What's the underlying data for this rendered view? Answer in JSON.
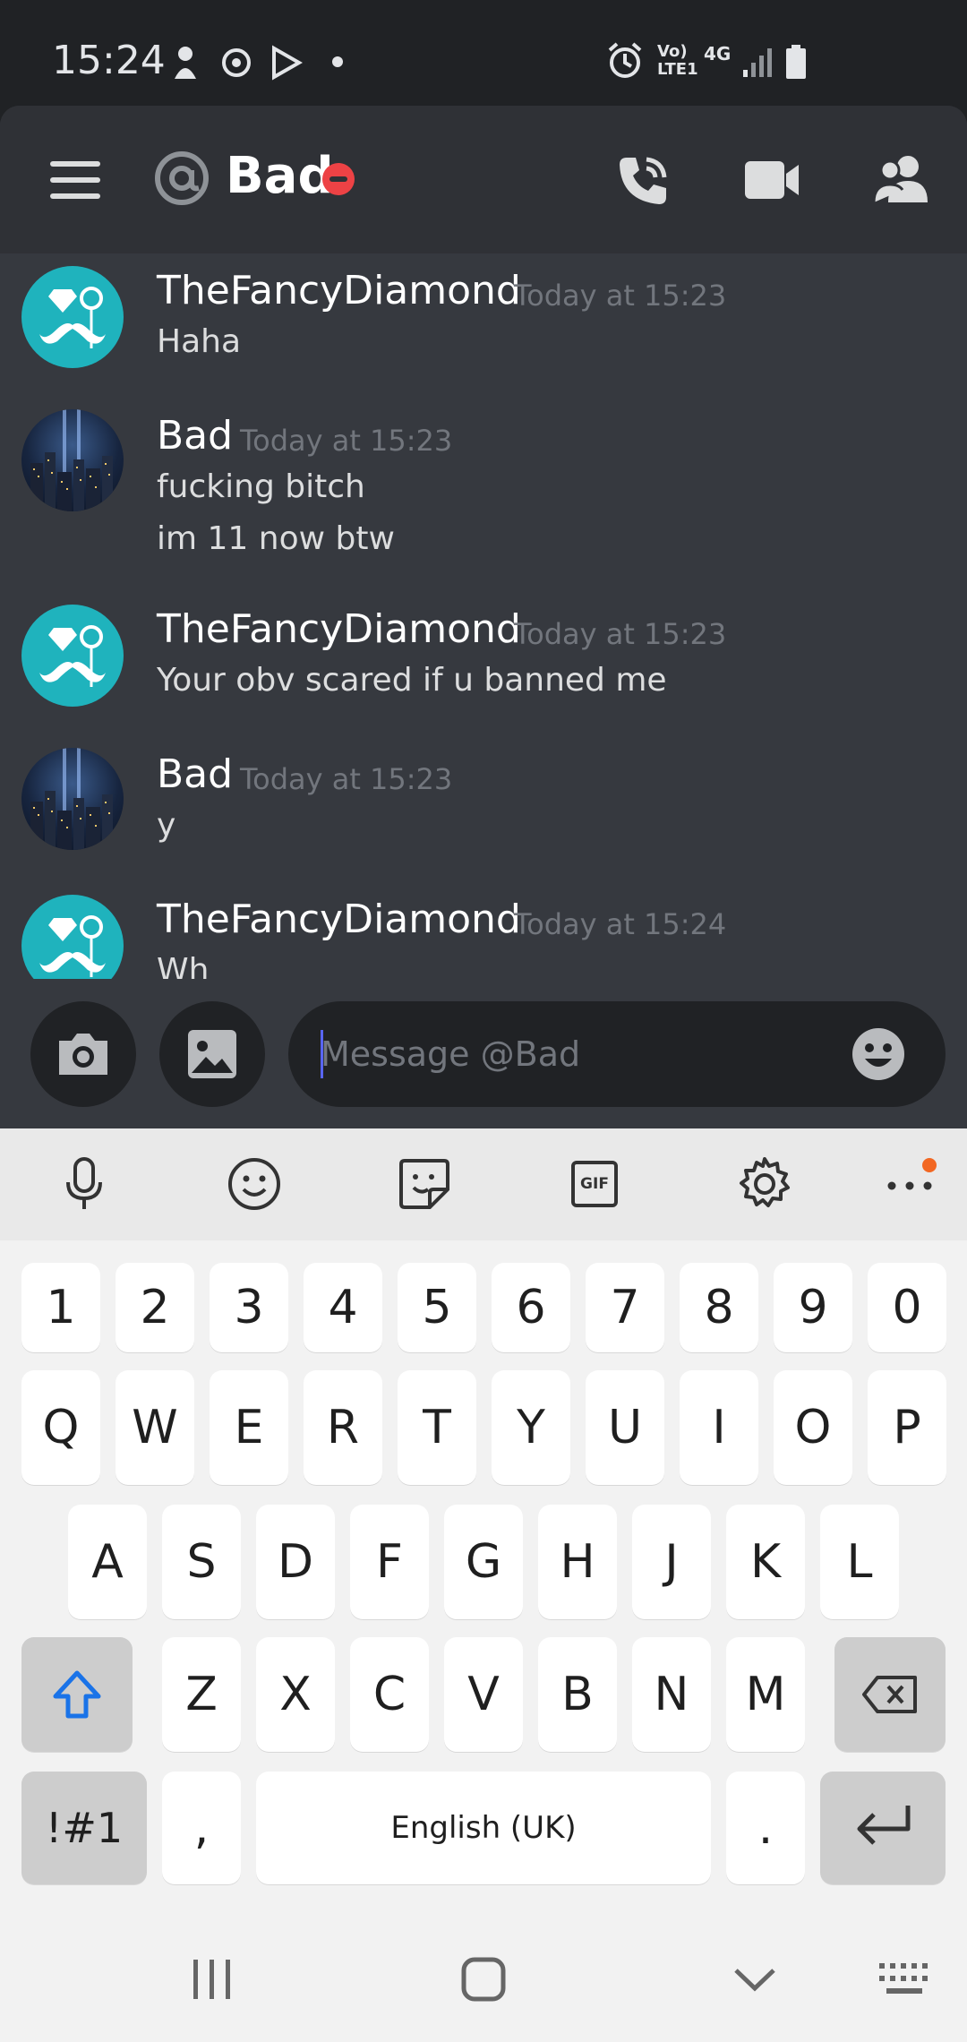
{
  "status_bar": {
    "time": "15:24",
    "network_label_top": "Vo)",
    "network_label_bottom": "LTE1",
    "network_type": "4G",
    "icons": [
      "notification-icon",
      "app-icon",
      "play-store-icon",
      "dot-icon",
      "alarm-icon",
      "signal-icon",
      "battery-icon"
    ]
  },
  "header": {
    "title": "Bad",
    "status": "do-not-disturb",
    "icons": [
      "menu-icon",
      "at-icon",
      "call-icon",
      "video-icon",
      "members-icon"
    ]
  },
  "messages": [
    {
      "author": "TheFancyDiamond",
      "time": "Today at 15:23",
      "lines": [
        "Haha"
      ],
      "avatar": "diamond"
    },
    {
      "author": "Bad",
      "time": "Today at 15:23",
      "lines": [
        "fucking bitch",
        "im 11 now btw"
      ],
      "avatar": "city"
    },
    {
      "author": "TheFancyDiamond",
      "time": "Today at 15:23",
      "lines": [
        "Your obv scared if u banned me"
      ],
      "avatar": "diamond"
    },
    {
      "author": "Bad",
      "time": "Today at 15:23",
      "lines": [
        "y"
      ],
      "avatar": "city"
    },
    {
      "author": "TheFancyDiamond",
      "time": "Today at 15:24",
      "lines": [
        "Wh"
      ],
      "avatar": "diamond"
    }
  ],
  "composer": {
    "placeholder": "Message @Bad"
  },
  "keyboard": {
    "toolbar": [
      "mic-icon",
      "emoji-icon",
      "sticker-icon",
      "gif-icon",
      "settings-icon",
      "more-icon"
    ],
    "gif_label": "GIF",
    "row_numbers": [
      "1",
      "2",
      "3",
      "4",
      "5",
      "6",
      "7",
      "8",
      "9",
      "0"
    ],
    "row1": [
      "Q",
      "W",
      "E",
      "R",
      "T",
      "Y",
      "U",
      "I",
      "O",
      "P"
    ],
    "row2": [
      "A",
      "S",
      "D",
      "F",
      "G",
      "H",
      "J",
      "K",
      "L"
    ],
    "row3": [
      "Z",
      "X",
      "C",
      "V",
      "B",
      "N",
      "M"
    ],
    "symbols_label": "!#1",
    "comma": ",",
    "space_label": "English (UK)",
    "period": "."
  },
  "colors": {
    "accent": "#5865f2",
    "dnd": "#ed4245",
    "diamond_avatar": "#1fb3bd",
    "shift_blue": "#1a73e8",
    "kb_notification": "#f26722"
  }
}
